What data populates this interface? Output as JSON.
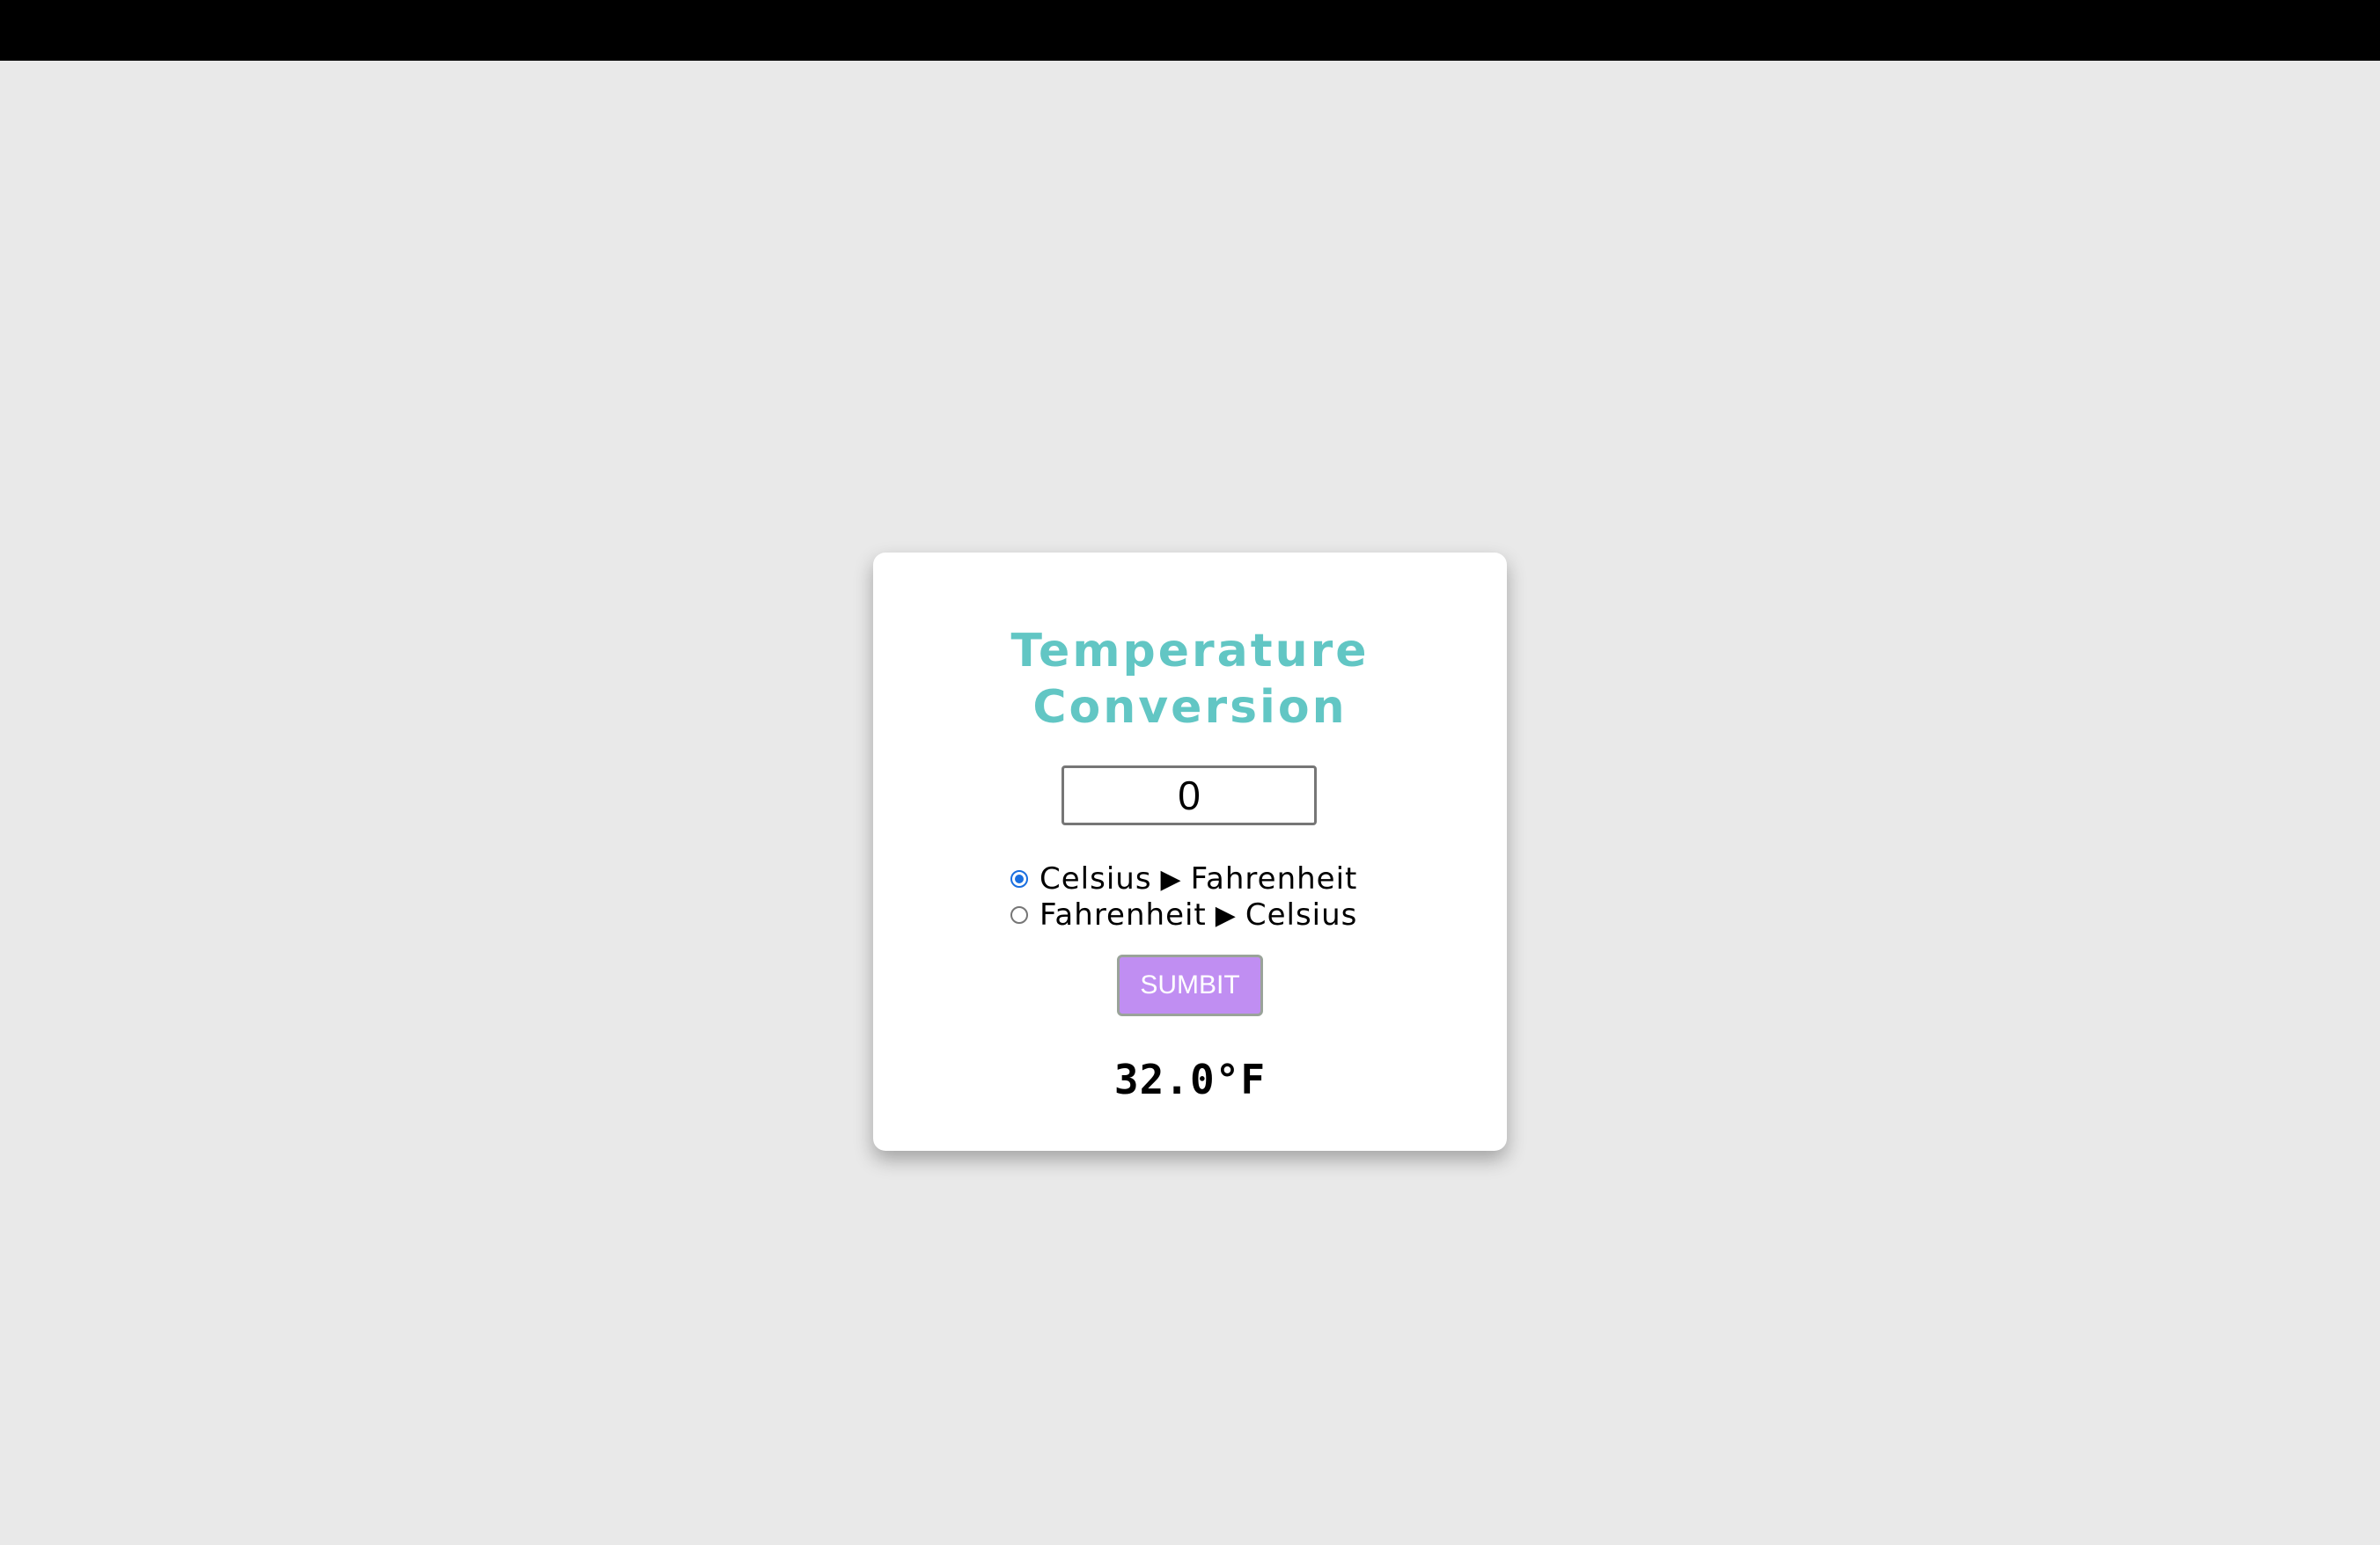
{
  "app": {
    "title_line1": "Temperature",
    "title_line2": "Conversion",
    "title_color": "#62c6c4"
  },
  "input": {
    "value": "0"
  },
  "options": [
    {
      "from": "Celsius",
      "arrow": "▶",
      "to": "Fahrenheit",
      "checked": true
    },
    {
      "from": "Fahrenheit",
      "arrow": "▶",
      "to": "Celsius",
      "checked": false
    }
  ],
  "submit": {
    "label": "SUMBIT",
    "color": "#c08ef2"
  },
  "result": {
    "text": "32.0°F"
  }
}
